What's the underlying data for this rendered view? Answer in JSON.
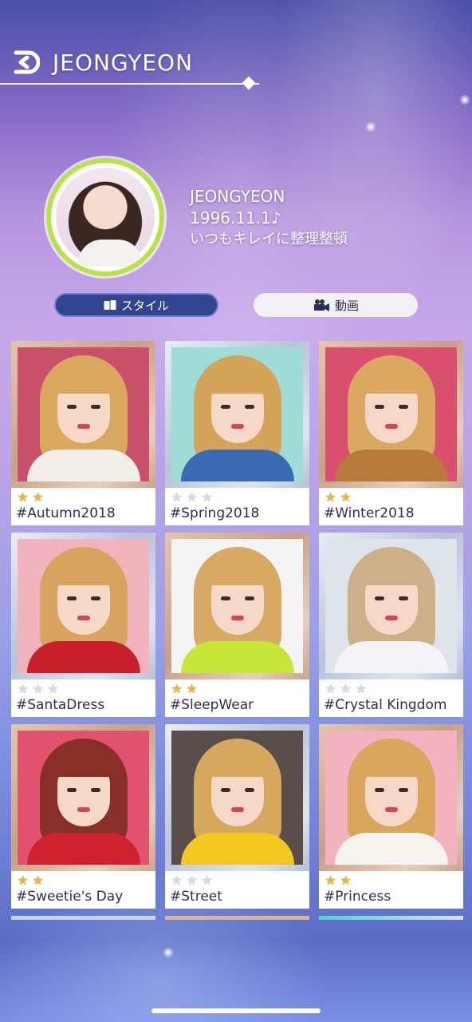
{
  "header": {
    "title": "JEONGYEON",
    "back_icon": "back-arrow-icon"
  },
  "profile": {
    "name": "JEONGYEON",
    "birthday": "1996.11.1♪",
    "motto": "いつもキレイに整理整頓",
    "ring_color": "#b7e24a"
  },
  "tabs": [
    {
      "label": "スタイル",
      "icon": "card-stack-icon",
      "active": true
    },
    {
      "label": "動画",
      "icon": "video-camera-icon",
      "active": false
    }
  ],
  "cards": [
    {
      "label": "#Autumn2018",
      "stars": 2,
      "frame": "gold",
      "bg": "#c8506a",
      "hair": "#d9a85e",
      "cloth": "#f2eee8"
    },
    {
      "label": "#Spring2018",
      "stars": 0,
      "frame": "silver",
      "bg": "#9fdcd8",
      "hair": "#d4a45a",
      "cloth": "#3a6ab2"
    },
    {
      "label": "#Winter2018",
      "stars": 2,
      "frame": "gold",
      "bg": "#d8506e",
      "hair": "#dba862",
      "cloth": "#b87a3a"
    },
    {
      "label": "#SantaDress",
      "stars": 0,
      "frame": "silver",
      "bg": "#f1b4bf",
      "hair": "#d8a35e",
      "cloth": "#c81f2a"
    },
    {
      "label": "#SleepWear",
      "stars": 2,
      "frame": "gold",
      "bg": "#f4f4f4",
      "hair": "#d7a962",
      "cloth": "#c8e63a"
    },
    {
      "label": "#Crystal Kingdom",
      "stars": 0,
      "frame": "silver",
      "bg": "#dfe4ea",
      "hair": "#cdb08a",
      "cloth": "#f4f4f6"
    },
    {
      "label": "#Sweetie's Day",
      "stars": 2,
      "frame": "gold",
      "bg": "#e1526e",
      "hair": "#8a2f28",
      "cloth": "#d0222e"
    },
    {
      "label": "#Street",
      "stars": 0,
      "frame": "silver",
      "bg": "#5a4e4a",
      "hair": "#d6a85e",
      "cloth": "#f2c81e"
    },
    {
      "label": "#Princess",
      "stars": 2,
      "frame": "gold",
      "bg": "#f2b2c0",
      "hair": "#d8a65c",
      "cloth": "#f6f4ee"
    }
  ]
}
